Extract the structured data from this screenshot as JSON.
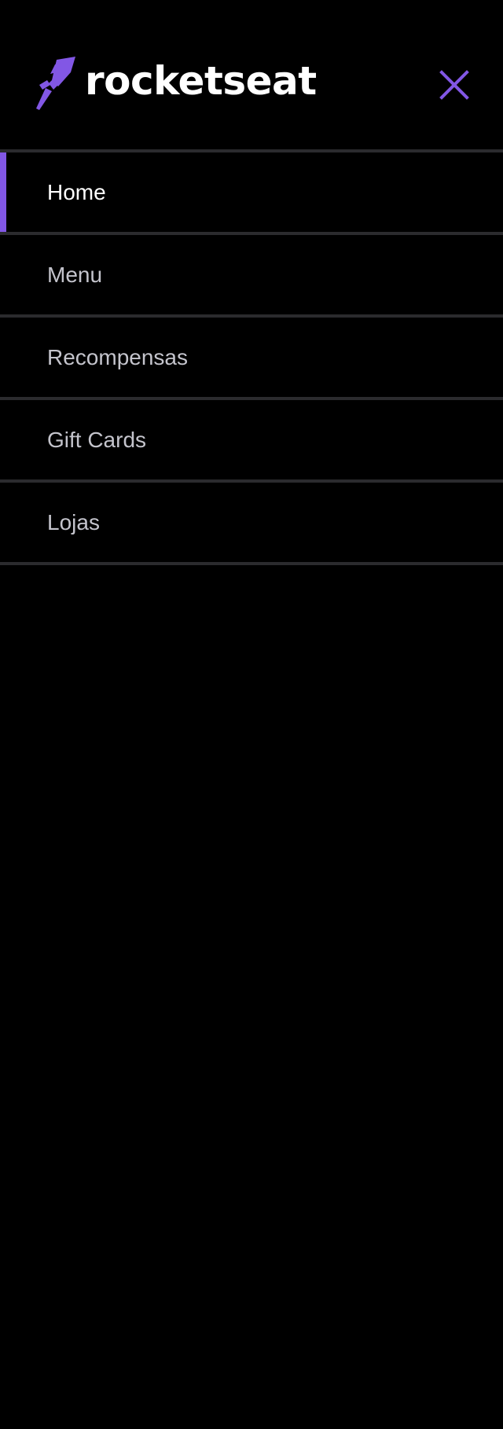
{
  "brand": {
    "name": "rocketseat",
    "accent": "#8257e5",
    "logo_icon": "rocket-icon"
  },
  "header": {
    "close_icon": "close-icon"
  },
  "nav": {
    "items": [
      {
        "label": "Home",
        "active": true
      },
      {
        "label": "Menu",
        "active": false
      },
      {
        "label": "Recompensas",
        "active": false
      },
      {
        "label": "Gift Cards",
        "active": false
      },
      {
        "label": "Lojas",
        "active": false
      }
    ]
  },
  "colors": {
    "background": "#000000",
    "divider": "#2b2b2e",
    "active_text": "#ffffff",
    "inactive_text": "#c4c4cc"
  }
}
